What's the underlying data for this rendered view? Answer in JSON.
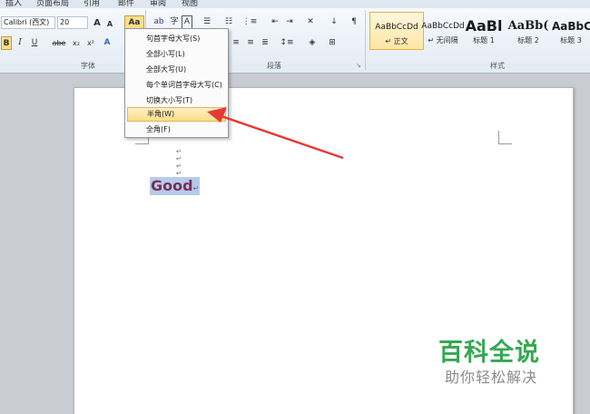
{
  "ribbon": {
    "tabs": [
      "插入",
      "页面布局",
      "引用",
      "邮件",
      "审阅",
      "视图"
    ],
    "font_name": "Calibri (西文)",
    "font_size": "20",
    "change_case_label": "Aa",
    "grow_font": "A",
    "shrink_font": "A",
    "bold": "B",
    "italic": "I",
    "underline": "U",
    "strikethrough": "abe",
    "subscript": "x₂",
    "superscript": "x²",
    "group_font": "字体",
    "group_paragraph": "段落",
    "group_styles": "样式"
  },
  "styles": [
    {
      "sample": "AaBbCcDd",
      "name": "↵ 正文"
    },
    {
      "sample": "AaBbCcDd",
      "name": "↵ 无间隔"
    },
    {
      "sample": "AaBl",
      "name": "标题 1"
    },
    {
      "sample": "AaBb(",
      "name": "标题 2"
    },
    {
      "sample": "AaBbC",
      "name": "标题 3"
    }
  ],
  "menu": {
    "items": [
      {
        "label": "句首字母大写(S)"
      },
      {
        "label": "全部小写(L)"
      },
      {
        "label": "全部大写(U)"
      },
      {
        "label": "每个单词首字母大写(C)"
      },
      {
        "label": "切换大小写(T)"
      },
      {
        "label": "半角(W)"
      },
      {
        "label": "全角(F)"
      }
    ],
    "highlighted_index": 5
  },
  "document": {
    "text": "Good",
    "para_mark": "↵"
  },
  "watermark": {
    "title": "百科全说",
    "subtitle": "助你轻松解决"
  },
  "colors": {
    "text_red": "#7b2f52",
    "selection": "#b6cbec",
    "arrow": "#e53935",
    "watermark_green": "#35a852"
  }
}
